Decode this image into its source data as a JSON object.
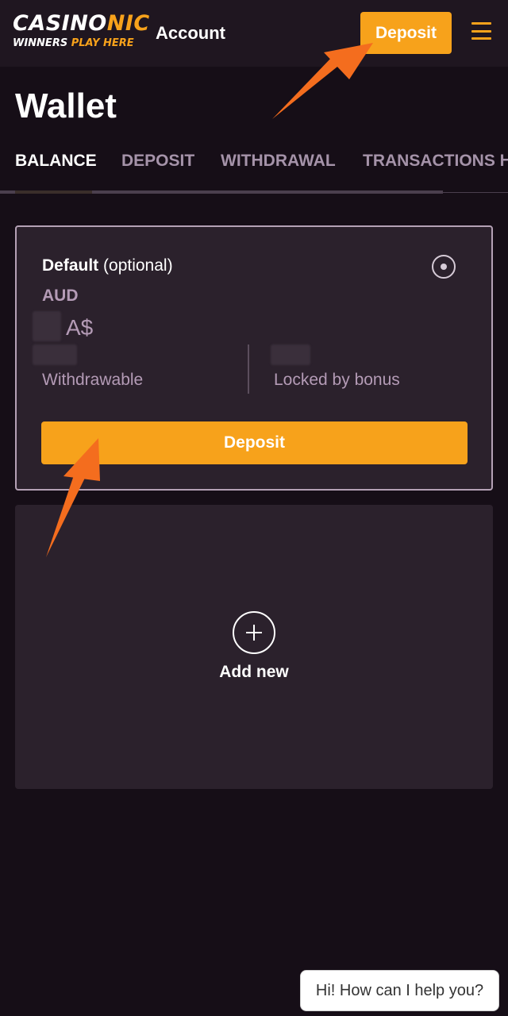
{
  "header": {
    "logo": {
      "main_white": "CASINO",
      "main_orange": "NIC",
      "sub_white": "WINNERS ",
      "sub_orange": "PLAY HERE"
    },
    "account_label": "Account",
    "deposit_label": "Deposit",
    "menu_icon": "hamburger-icon"
  },
  "page": {
    "title": "Wallet"
  },
  "tabs": [
    {
      "label": "BALANCE",
      "active": true
    },
    {
      "label": "DEPOSIT",
      "active": false
    },
    {
      "label": "WITHDRAWAL",
      "active": false
    },
    {
      "label": "TRANSACTIONS H",
      "active": false
    }
  ],
  "wallet": {
    "label_bold": "Default",
    "label_rest": " (optional)",
    "currency_code": "AUD",
    "currency_symbol": "A$",
    "withdrawable_label": "Withdrawable",
    "locked_label": "Locked by bonus",
    "deposit_label": "Deposit"
  },
  "add_new": {
    "label": "Add new",
    "icon": "plus-circle-icon"
  },
  "chat": {
    "text": "Hi! How can I help you?"
  },
  "colors": {
    "background": "#160e17",
    "header": "#1f1620",
    "card": "#2b212c",
    "accent": "#f7a21b",
    "muted_text": "#b49bb6",
    "annotation_arrow": "#f46d1e"
  }
}
